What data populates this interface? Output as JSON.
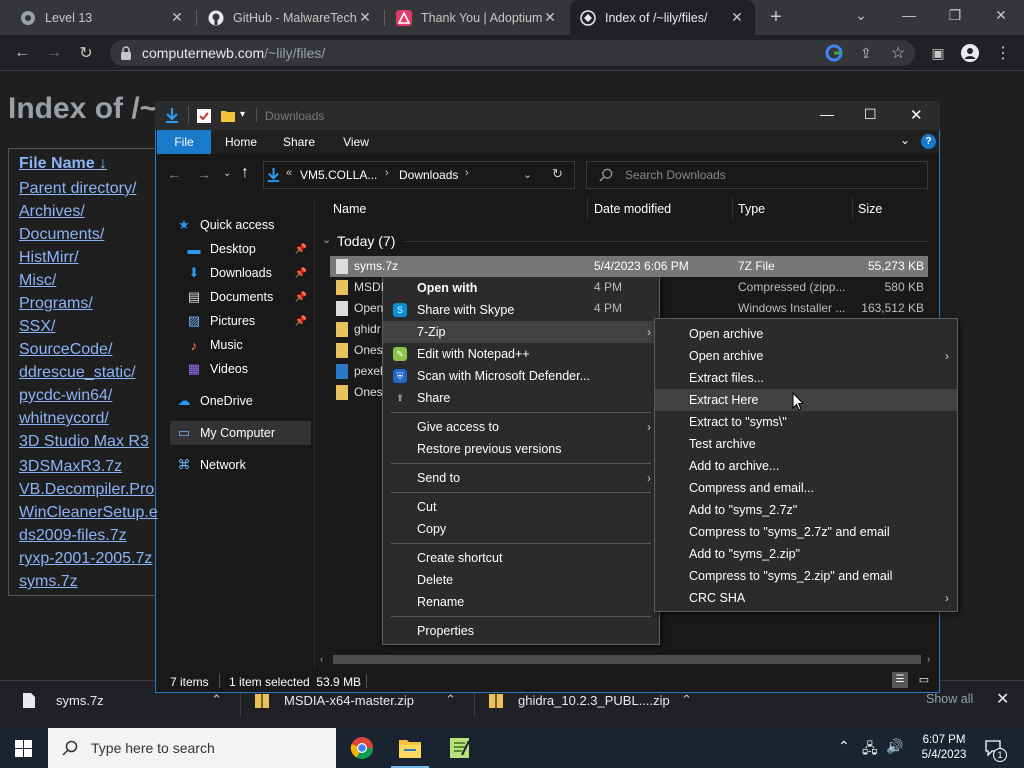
{
  "browser": {
    "tabs": [
      {
        "title": "Level 13"
      },
      {
        "title": "GitHub - MalwareTech/"
      },
      {
        "title": "Thank You | Adoptium"
      },
      {
        "title": "Index of /~lily/files/"
      }
    ],
    "url_host": "computernewb.com",
    "url_path": "/~lily/files/"
  },
  "page": {
    "heading": "Index of /~",
    "column_header": "File Name",
    "sort_arrow": "↓",
    "links": [
      "Parent directory/",
      "Archives/",
      "Documents/",
      "HistMirr/",
      "Misc/",
      "Programs/",
      "SSX/",
      "SourceCode/",
      "ddrescue_static/",
      "pycdc-win64/",
      "whitneycord/",
      "3D Studio Max R3",
      "3DSMaxR3.7z",
      "VB.Decompiler.Pro",
      "WinCleanerSetup.e",
      "ds2009-files.7z",
      "ryxp-2001-2005.7z",
      "syms.7z"
    ]
  },
  "explorer": {
    "title": "Downloads",
    "ribbon_tabs": [
      "File",
      "Home",
      "Share",
      "View"
    ],
    "breadcrumb": [
      "VM5.COLLA...",
      "Downloads"
    ],
    "search_placeholder": "Search Downloads",
    "nav": [
      {
        "label": "Quick access",
        "icon": "star-icon"
      },
      {
        "label": "Desktop",
        "icon": "desktop-icon",
        "pinned": true
      },
      {
        "label": "Downloads",
        "icon": "download-icon",
        "pinned": true
      },
      {
        "label": "Documents",
        "icon": "documents-icon",
        "pinned": true
      },
      {
        "label": "Pictures",
        "icon": "pictures-icon",
        "pinned": true
      },
      {
        "label": "Music",
        "icon": "music-icon"
      },
      {
        "label": "Videos",
        "icon": "videos-icon"
      },
      {
        "label": "OneDrive",
        "icon": "cloud-icon"
      },
      {
        "label": "My Computer",
        "icon": "computer-icon"
      },
      {
        "label": "Network",
        "icon": "network-icon"
      }
    ],
    "columns": [
      "Name",
      "Date modified",
      "Type",
      "Size"
    ],
    "group": "Today (7)",
    "files": [
      {
        "name": "syms.7z",
        "date": "5/4/2023 6:06 PM",
        "type": "7Z File",
        "size": "55,273 KB"
      },
      {
        "name": "MSDI",
        "date": "4 PM",
        "type": "Compressed (zipp...",
        "size": "580 KB"
      },
      {
        "name": "Open",
        "date": "4 PM",
        "type": "Windows Installer ...",
        "size": "163,512 KB"
      },
      {
        "name": "ghidr",
        "date": "",
        "type": "",
        "size": ""
      },
      {
        "name": "Ones",
        "date": "",
        "type": "",
        "size": ""
      },
      {
        "name": "pexel",
        "date": "",
        "type": "",
        "size": ""
      },
      {
        "name": "Ones",
        "date": "",
        "type": "",
        "size": ""
      }
    ],
    "status": {
      "items": "7 items",
      "selected": "1 item selected  53.9 MB"
    }
  },
  "context_menu": [
    {
      "label": "Open with",
      "bold": true
    },
    {
      "label": "Share with Skype",
      "icon": "skype-icon"
    },
    {
      "label": "7-Zip",
      "submenu": true,
      "highlight": true
    },
    {
      "label": "Edit with Notepad++",
      "icon": "notepadpp-icon"
    },
    {
      "label": "Scan with Microsoft Defender...",
      "icon": "defender-icon"
    },
    {
      "label": "Share",
      "icon": "share-icon"
    },
    {
      "sep": true
    },
    {
      "label": "Give access to",
      "submenu": true
    },
    {
      "label": "Restore previous versions"
    },
    {
      "sep": true
    },
    {
      "label": "Send to",
      "submenu": true
    },
    {
      "sep": true
    },
    {
      "label": "Cut"
    },
    {
      "label": "Copy"
    },
    {
      "sep": true
    },
    {
      "label": "Create shortcut"
    },
    {
      "label": "Delete"
    },
    {
      "label": "Rename"
    },
    {
      "sep": true
    },
    {
      "label": "Properties"
    }
  ],
  "zip_menu": [
    {
      "label": "Open archive"
    },
    {
      "label": "Open archive",
      "submenu": true
    },
    {
      "label": "Extract files..."
    },
    {
      "label": "Extract Here",
      "highlight": true
    },
    {
      "label": "Extract to \"syms\\\""
    },
    {
      "label": "Test archive"
    },
    {
      "label": "Add to archive..."
    },
    {
      "label": "Compress and email..."
    },
    {
      "label": "Add to \"syms_2.7z\""
    },
    {
      "label": "Compress to \"syms_2.7z\" and email"
    },
    {
      "label": "Add to \"syms_2.zip\""
    },
    {
      "label": "Compress to \"syms_2.zip\" and email"
    },
    {
      "label": "CRC SHA",
      "submenu": true
    }
  ],
  "downloads_bar": {
    "items": [
      "syms.7z",
      "MSDIA-x64-master.zip",
      "ghidra_10.2.3_PUBL....zip"
    ],
    "show_all": "Show all"
  },
  "taskbar": {
    "search_placeholder": "Type here to search",
    "time": "6:07 PM",
    "date": "5/4/2023",
    "notification_count": "1"
  }
}
